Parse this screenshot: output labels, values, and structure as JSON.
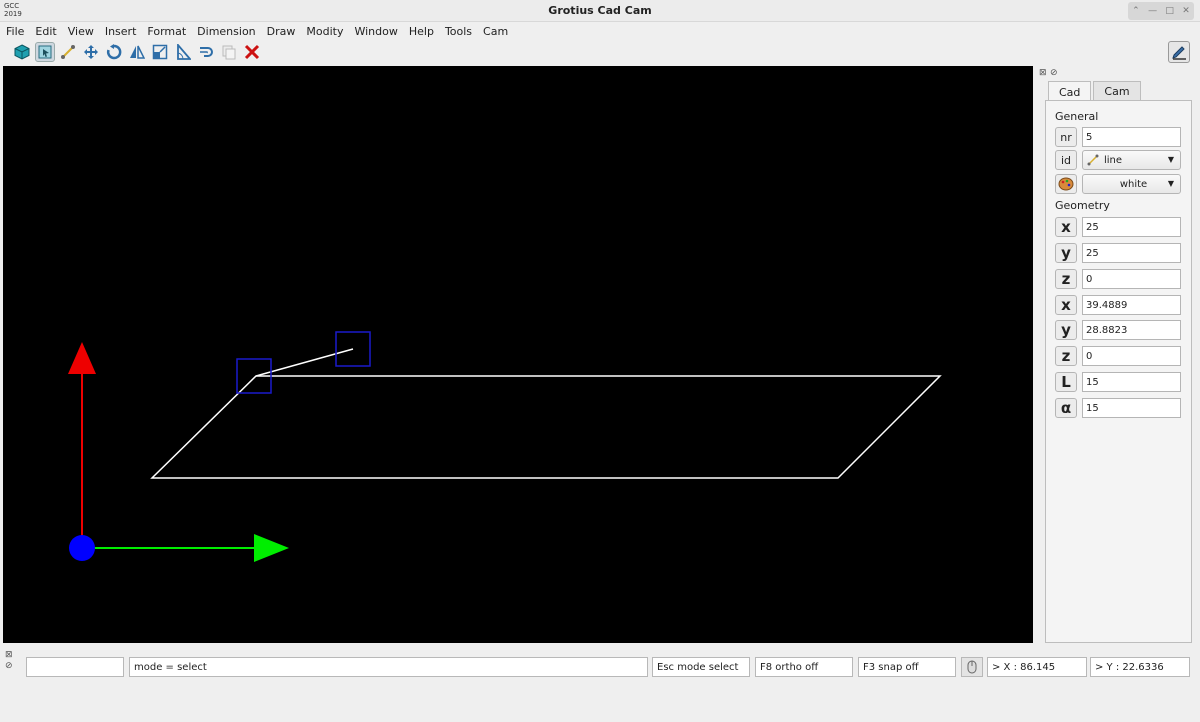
{
  "app": {
    "logo_line1": "GCC",
    "logo_line2": "2019",
    "title": "Grotius Cad Cam"
  },
  "menu": [
    "File",
    "Edit",
    "View",
    "Insert",
    "Format",
    "Dimension",
    "Draw",
    "Modity",
    "Window",
    "Help",
    "Tools",
    "Cam"
  ],
  "toolbar": {
    "icons": [
      "cube-icon",
      "select-icon",
      "line-icon",
      "move-icon",
      "rotate-icon",
      "mirror-icon",
      "scale-icon",
      "angle-icon",
      "offset-icon",
      "copy-icon",
      "delete-icon"
    ],
    "right_icon": "pencil-icon",
    "colors": {
      "cube": "#1fa0b0",
      "delete": "#cc1111"
    }
  },
  "panel": {
    "tabs": [
      "Cad",
      "Cam"
    ],
    "active_tab": "Cad",
    "general_heading": "General",
    "nr_label": "nr",
    "nr_value": "5",
    "id_label": "id",
    "id_value": "line",
    "color_value": "white",
    "geometry_heading": "Geometry",
    "geometry": [
      {
        "label": "x",
        "value": "25"
      },
      {
        "label": "y",
        "value": "25"
      },
      {
        "label": "z",
        "value": "0"
      },
      {
        "label": "x",
        "value": "39.4889"
      },
      {
        "label": "y",
        "value": "28.8823"
      },
      {
        "label": "z",
        "value": "0"
      },
      {
        "label": "L",
        "value": "15"
      },
      {
        "label": "α",
        "value": "15"
      }
    ]
  },
  "status": {
    "blank": "",
    "mode": "mode = select",
    "esc": "Esc mode select",
    "ortho": "F8 ortho off",
    "snap": "F3 snap off",
    "x_readout": "> X : 86.145",
    "y_readout": "> Y : 22.6336"
  },
  "colors": {
    "x_axis": "#00ee00",
    "y_axis": "#ee0000",
    "origin": "#0000ff",
    "geometry": "#ffffff",
    "snap_box": "#1a1acc"
  }
}
